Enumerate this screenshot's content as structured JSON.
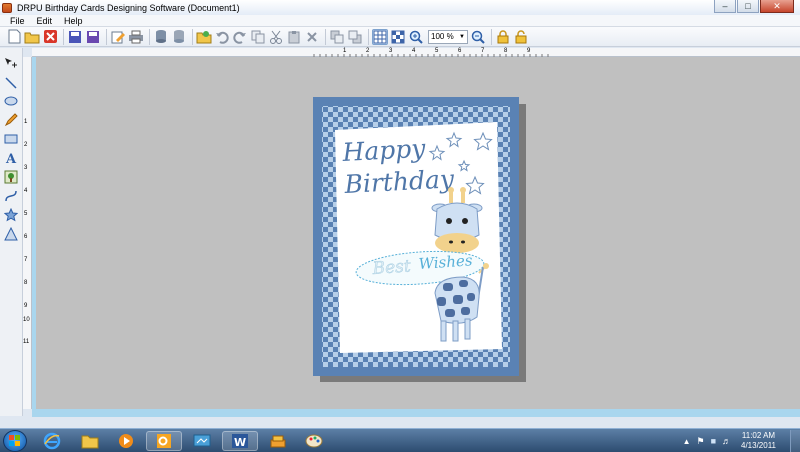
{
  "window": {
    "title": "DRPU Birthday Cards Designing Software  (Document1)"
  },
  "menu": {
    "items": [
      "File",
      "Edit",
      "Help"
    ]
  },
  "toolbar": {
    "zoom_value": "100 %"
  },
  "ruler": {
    "h_numbers": [
      "1",
      "2",
      "3",
      "4",
      "5",
      "6",
      "7",
      "8",
      "9"
    ],
    "v_numbers": [
      "1",
      "2",
      "3",
      "4",
      "5",
      "6",
      "7",
      "8",
      "9",
      "10",
      "11"
    ]
  },
  "card": {
    "line1": "Happy",
    "line2": "Birthday",
    "wish_word1": "Best",
    "wish_word2": "Wishes"
  },
  "taskbar": {
    "time": "11:02 AM",
    "date": "4/13/2011"
  },
  "colors": {
    "card_blue": "#5a82b4",
    "card_light": "#b6cfe9",
    "text_blue": "#4f76a8",
    "canvas_gray": "#c0c0c0",
    "accent_sky": "#a9d6ee"
  }
}
